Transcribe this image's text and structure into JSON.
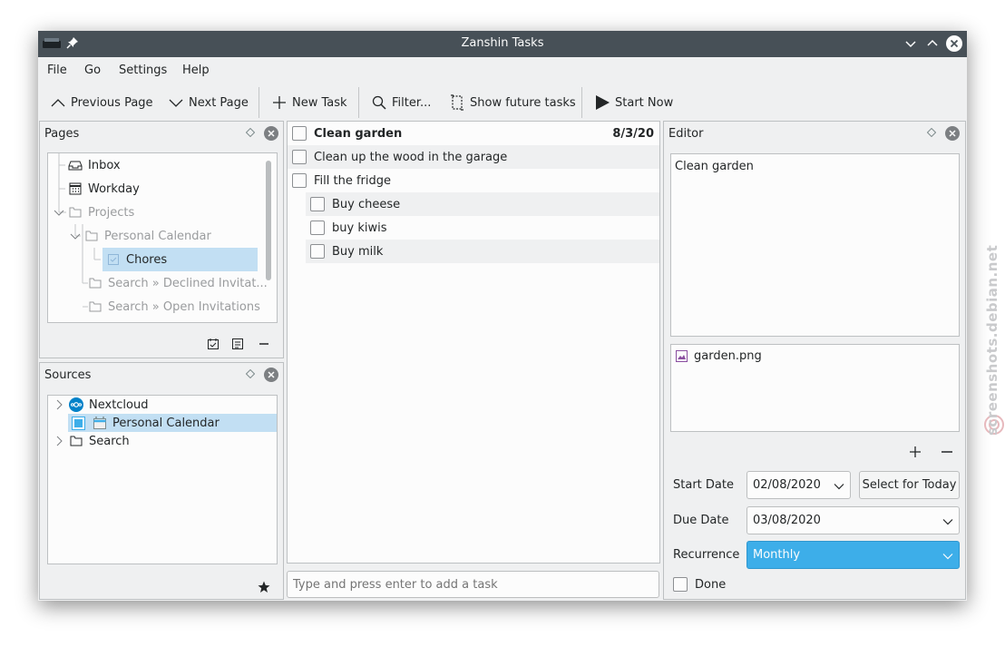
{
  "window": {
    "title": "Zanshin Tasks"
  },
  "menu": {
    "file": "File",
    "go": "Go",
    "settings": "Settings",
    "help": "Help"
  },
  "toolbar": {
    "previous_page": "Previous Page",
    "next_page": "Next Page",
    "new_task": "New Task",
    "filter": "Filter...",
    "show_future": "Show future tasks",
    "start_now": "Start Now"
  },
  "pages": {
    "title": "Pages",
    "items": [
      {
        "label": "Inbox",
        "icon": "inbox-icon"
      },
      {
        "label": "Workday",
        "icon": "calendar-icon"
      },
      {
        "label": "Projects",
        "icon": "folder-icon"
      },
      {
        "label": "Personal Calendar",
        "icon": "folder-icon"
      },
      {
        "label": "Chores",
        "icon": "task-list-icon"
      },
      {
        "label": "Search » Declined Invitat...",
        "icon": "folder-icon"
      },
      {
        "label": "Search » Open Invitations",
        "icon": "folder-icon"
      }
    ]
  },
  "sources": {
    "title": "Sources",
    "items": [
      {
        "label": "Nextcloud",
        "icon": "nextcloud-icon"
      },
      {
        "label": "Personal Calendar",
        "icon": "calendar-icon"
      },
      {
        "label": "Search",
        "icon": "folder-icon"
      }
    ]
  },
  "tasks": {
    "items": [
      {
        "title": "Clean garden",
        "date": "8/3/20"
      },
      {
        "title": "Clean up the wood in the garage"
      },
      {
        "title": "Fill the fridge"
      },
      {
        "title": "Buy cheese"
      },
      {
        "title": "buy kiwis"
      },
      {
        "title": "Buy milk"
      }
    ],
    "add_placeholder": "Type and press enter to add a task"
  },
  "editor": {
    "title": "Editor",
    "text": "Clean garden",
    "attachment": "garden.png",
    "start_date_label": "Start Date",
    "start_date": "02/08/2020",
    "select_today": "Select for Today",
    "due_date_label": "Due Date",
    "due_date": "03/08/2020",
    "recurrence_label": "Recurrence",
    "recurrence": "Monthly",
    "done_label": "Done"
  },
  "colors": {
    "titlebar": "#475057",
    "selection": "#c2dff3",
    "accent": "#3daee9"
  },
  "watermark": "screenshots.debian.net"
}
